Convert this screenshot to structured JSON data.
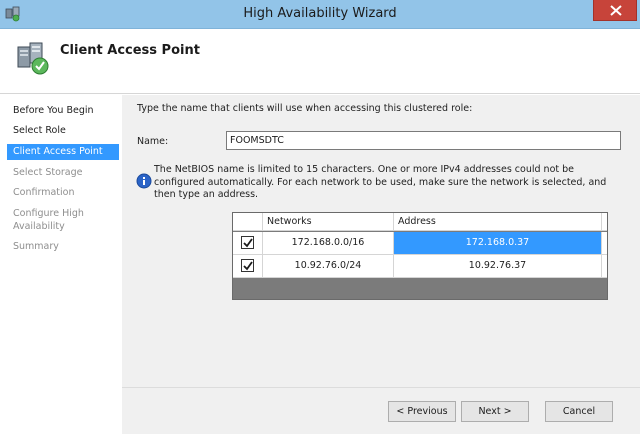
{
  "window": {
    "title": "High Availability Wizard",
    "close_icon": "close-icon",
    "app_icon": "cluster-icon"
  },
  "header": {
    "title": "Client Access Point",
    "icon": "server-cluster-icon"
  },
  "sidebar": {
    "items": [
      {
        "label": "Before You Begin",
        "state": "normal"
      },
      {
        "label": "Select Role",
        "state": "normal"
      },
      {
        "label": "Client Access Point",
        "state": "active"
      },
      {
        "label": "Select Storage",
        "state": "disabled"
      },
      {
        "label": "Confirmation",
        "state": "disabled"
      },
      {
        "label": "Configure High Availability",
        "state": "disabled"
      },
      {
        "label": "Summary",
        "state": "disabled"
      }
    ]
  },
  "main": {
    "instruction": "Type the name that clients will use when accessing this clustered role:",
    "name_label": "Name:",
    "name_value": "FOOMSDTC",
    "info_icon": "info-icon",
    "info_text": "The NetBIOS name is limited to 15 characters.  One or more IPv4 addresses could not be configured automatically.  For each network to be used, make sure the network is selected, and then type an address.",
    "grid": {
      "columns": [
        "",
        "Networks",
        "Address"
      ],
      "rows": [
        {
          "checked": true,
          "network": "172.168.0.0/16",
          "address": "172.168.0.37",
          "selected": true
        },
        {
          "checked": true,
          "network": "10.92.76.0/24",
          "address": "10.92.76.37",
          "selected": false
        }
      ]
    }
  },
  "footer": {
    "previous_label": "< Previous",
    "next_label": "Next >",
    "cancel_label": "Cancel"
  },
  "colors": {
    "titlebar": "#92c4e8",
    "accent": "#3399ff",
    "close": "#c7443a",
    "content_bg": "#f0f0f0",
    "grid_bg": "#7b7b7b"
  }
}
